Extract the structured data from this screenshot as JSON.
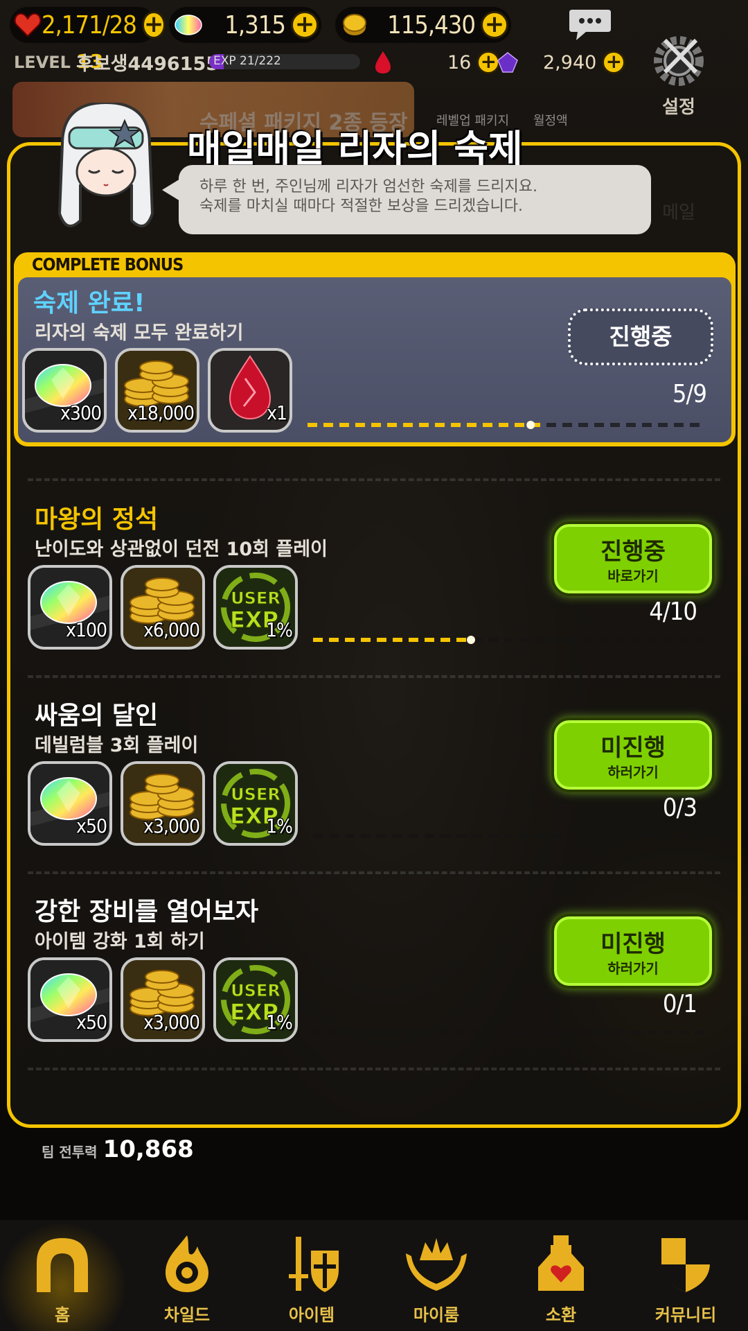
{
  "topbar": {
    "hearts": "2,171/28",
    "gems": "1,315",
    "gold": "115,430",
    "level_label": "LEVEL",
    "level": "13",
    "nickname": "후보생4496155",
    "exp": "EXP 21/222",
    "exp_progress": 0.095,
    "red_stones": "16",
    "purple_stones": "2,940",
    "settings_label": "설정"
  },
  "background": {
    "mail_label": "메일",
    "banner_text": "수페셜 패키지 2종 등장",
    "pkg1": "레벨업 패키지",
    "pkg2": "월정액"
  },
  "panel": {
    "title": "매일매일 리자의 숙제",
    "speech_line1": "하루 한 번, 주인님께 리자가 엄선한 숙제를 드리지요.",
    "speech_line2": "숙제를 마치실 때마다 적절한 보상을 드리겠습니다."
  },
  "bonus": {
    "header": "COMPLETE BONUS",
    "title": "숙제 완료!",
    "desc": "리자의 숙제 모두 완료하기",
    "status": "진행중",
    "progress": "5/9",
    "progress_value": 5,
    "progress_max": 9,
    "rewards": [
      {
        "icon": "rainbow-gem-icon",
        "count": "x300"
      },
      {
        "icon": "gold-coins-icon",
        "count": "x18,000"
      },
      {
        "icon": "red-stone-icon",
        "count": "x1"
      }
    ]
  },
  "quests": [
    {
      "title": "마왕의 정석",
      "desc": "난이도와 상관없이 던전 10회 플레이",
      "status": "진행중",
      "action": "바로가기",
      "progress": "4/10",
      "progress_value": 4,
      "progress_max": 10,
      "rewards": [
        {
          "icon": "rainbow-gem-icon",
          "count": "x100"
        },
        {
          "icon": "gold-coins-icon",
          "count": "x6,000"
        },
        {
          "icon": "user-exp-icon",
          "count": "1%"
        }
      ]
    },
    {
      "title": "싸움의 달인",
      "desc": "데빌럼블 3회 플레이",
      "status": "미진행",
      "action": "하러가기",
      "progress": "0/3",
      "progress_value": 0,
      "progress_max": 3,
      "rewards": [
        {
          "icon": "rainbow-gem-icon",
          "count": "x50"
        },
        {
          "icon": "gold-coins-icon",
          "count": "x3,000"
        },
        {
          "icon": "user-exp-icon",
          "count": "1%"
        }
      ]
    },
    {
      "title": "강한 장비를 열어보자",
      "desc": "아이템 강화 1회 하기",
      "status": "미진행",
      "action": "하러가기",
      "progress": "0/1",
      "progress_value": 0,
      "progress_max": 1,
      "rewards": [
        {
          "icon": "rainbow-gem-icon",
          "count": "x50"
        },
        {
          "icon": "gold-coins-icon",
          "count": "x3,000"
        },
        {
          "icon": "user-exp-icon",
          "count": "1%"
        }
      ]
    }
  ],
  "team_power": {
    "label": "팀 전투력",
    "value": "10,868"
  },
  "nav": [
    {
      "label": "홈",
      "icon": "home-arch-icon"
    },
    {
      "label": "차일드",
      "icon": "child-flame-icon"
    },
    {
      "label": "아이템",
      "icon": "item-sword-shield-icon"
    },
    {
      "label": "마이룸",
      "icon": "myroom-crown-icon"
    },
    {
      "label": "소환",
      "icon": "summon-potion-icon"
    },
    {
      "label": "커뮤니티",
      "icon": "community-shield-icon"
    }
  ],
  "colors": {
    "accent": "#f5c400",
    "button_green": "#7fd000",
    "panel_bg": "#4b4f66"
  }
}
